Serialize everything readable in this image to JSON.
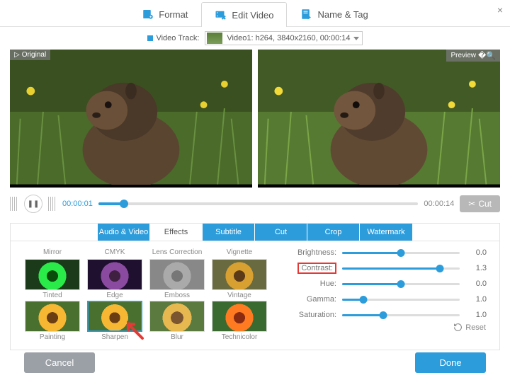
{
  "topTabs": {
    "format": "Format",
    "edit": "Edit Video",
    "name": "Name & Tag"
  },
  "close": "×",
  "track": {
    "label": "Video Track:",
    "value": "Video1: h264, 3840x2160, 00:00:14"
  },
  "preview": {
    "original": "Original",
    "preview": "Preview"
  },
  "timeline": {
    "current": "00:00:01",
    "total": "00:00:14",
    "cut": "Cut",
    "progress": 8
  },
  "subTabs": [
    "Audio & Video",
    "Effects",
    "Subtitle",
    "Cut",
    "Crop",
    "Watermark"
  ],
  "activeSubTab": 1,
  "fxHeaders": [
    "Mirror",
    "CMYK",
    "Lens Correction",
    "Vignette"
  ],
  "fxRow1": [
    "Tinted",
    "Edge",
    "Emboss",
    "Vintage"
  ],
  "fxRow2": [
    "Painting",
    "Sharpen",
    "Blur",
    "Technicolor"
  ],
  "selectedFx": "Sharpen",
  "sliders": [
    {
      "label": "Brightness:",
      "value": "0.0",
      "pct": 50
    },
    {
      "label": "Contrast:",
      "value": "1.3",
      "pct": 83,
      "highlight": true
    },
    {
      "label": "Hue:",
      "value": "0.0",
      "pct": 50
    },
    {
      "label": "Gamma:",
      "value": "1.0",
      "pct": 18
    },
    {
      "label": "Saturation:",
      "value": "1.0",
      "pct": 35
    }
  ],
  "reset": "Reset",
  "buttons": {
    "cancel": "Cancel",
    "done": "Done"
  }
}
